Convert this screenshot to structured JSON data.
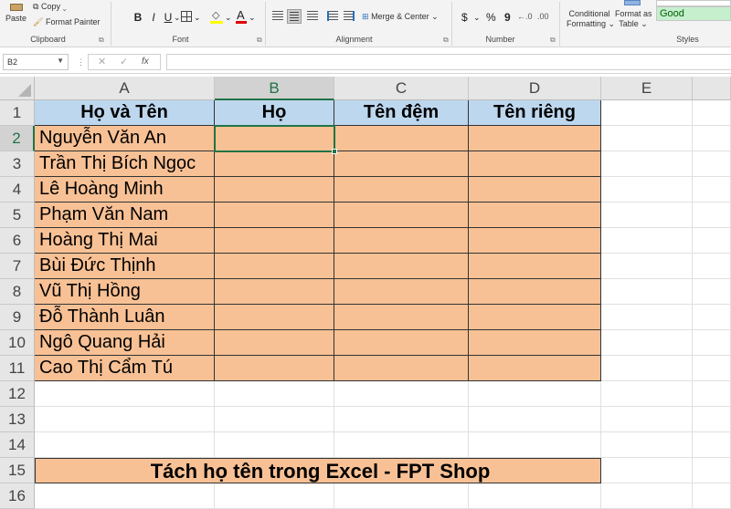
{
  "ribbon": {
    "clipboard": {
      "paste": "Paste",
      "copy": "Copy",
      "format_painter": "Format Painter",
      "label": "Clipboard"
    },
    "font": {
      "bold": "B",
      "italic": "I",
      "underline": "U",
      "font_color": "A",
      "label": "Font"
    },
    "alignment": {
      "merge_center": "Merge & Center",
      "label": "Alignment"
    },
    "number": {
      "currency": "$",
      "percent": "%",
      "comma": "9",
      "label": "Number"
    },
    "styles": {
      "conditional_1": "Conditional",
      "conditional_2": "Formatting",
      "format_table_1": "Format as",
      "format_table_2": "Table",
      "good": "Good",
      "label": "Styles"
    }
  },
  "formula_bar": {
    "name_box": "B2",
    "fx": "fx",
    "formula": ""
  },
  "columns": [
    "A",
    "B",
    "C",
    "D",
    "E"
  ],
  "rows": [
    "1",
    "2",
    "3",
    "4",
    "5",
    "6",
    "7",
    "8",
    "9",
    "10",
    "11",
    "12",
    "13",
    "14",
    "15",
    "16"
  ],
  "table": {
    "headers": [
      "Họ và Tên",
      "Họ",
      "Tên đệm",
      "Tên riêng"
    ],
    "names": [
      "Nguyễn Văn An",
      "Trần Thị Bích Ngọc",
      "Lê Hoàng Minh",
      "Phạm Văn Nam",
      "Hoàng Thị Mai",
      "Bùi Đức Thịnh",
      "Vũ Thị Hồng",
      "Đỗ Thành Luân",
      "Ngô Quang Hải",
      "Cao Thị Cẩm Tú"
    ]
  },
  "banner": "Tách họ tên trong Excel - FPT Shop",
  "colors": {
    "header_fill": "#bdd7ee",
    "body_fill": "#f8c195",
    "good_fill": "#c6efce",
    "selection": "#217346"
  }
}
